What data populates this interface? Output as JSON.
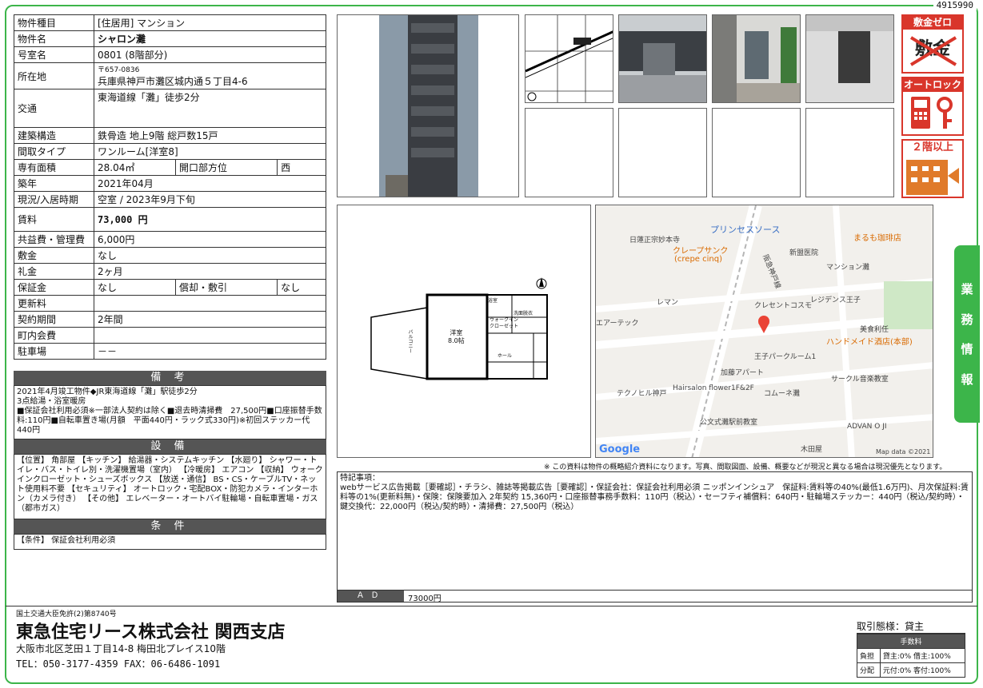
{
  "property_id": "4915990",
  "spec": {
    "type_label": "物件種目",
    "type_value": "[住居用] マンション",
    "name_label": "物件名",
    "name_value": "シャロン灘",
    "room_label": "号室名",
    "room_value": "0801 (8階部分)",
    "address_label": "所在地",
    "zip": "〒657-0836",
    "address_value": "兵庫県神戸市灘区城内通５丁目4-6",
    "transport_label": "交通",
    "transport_value": "東海道線「灘」徒歩2分",
    "structure_label": "建築構造",
    "structure_value": "鉄骨造 地上9階 総戸数15戸",
    "layout_label": "間取タイプ",
    "layout_value": "ワンルーム[洋室8]",
    "area_label": "専有面積",
    "area_value": "28.04㎡",
    "opening_label": "開口部方位",
    "opening_value": "西",
    "built_label": "築年",
    "built_value": "2021年04月",
    "status_label": "現況/入居時期",
    "status_value": "空室 / 2023年9月下旬",
    "rent_label": "賃料",
    "rent_value": "73,000 円",
    "mgmt_label": "共益費・管理費",
    "mgmt_value": "6,000円",
    "deposit_label": "敷金",
    "deposit_value": "なし",
    "key_money_label": "礼金",
    "key_money_value": "2ヶ月",
    "guarantee_label": "保証金",
    "guarantee_value": "なし",
    "amort_label": "償却・敷引",
    "amort_value": "なし",
    "renewal_label": "更新料",
    "renewal_value": "",
    "contract_label": "契約期間",
    "contract_value": "2年間",
    "town_fee_label": "町内会費",
    "town_fee_value": "",
    "parking_label": "駐車場",
    "parking_value": "－－"
  },
  "remarks": {
    "title": "備 考",
    "text": "2021年4月竣工物件◆JR東海道線「灘」駅徒歩2分\n3点給湯・浴室暖房\n■保証会社利用必須※一部法人契約は除く■退去時清掃費　27,500円■口座振替手数料:110円■自転車置き場(月額　平面440円・ラック式330円)※初回ステッカー代440円"
  },
  "equipment": {
    "title": "設 備",
    "text": "【位置】 角部屋 【キッチン】 給湯器・システムキッチン 【水廻り】 シャワー・トイレ・バス・トイレ別・洗濯機置場（室内） 【冷暖房】 エアコン 【収納】 ウォークインクローゼット・シューズボックス 【放送・通信】 BS・CS・ケーブルTV・ネット使用料不要 【セキュリティ】 オートロック・宅配BOX・防犯カメラ・インターホン（カメラ付き） 【その他】 エレベーター・オートバイ駐輪場・自転車置場・ガス（都市ガス）"
  },
  "conditions": {
    "title": "条 件",
    "text": "【条件】 保証会社利用必須"
  },
  "badges": {
    "no_deposit": "敷金ゼロ",
    "no_deposit_strike": "敷金",
    "autolock": "オートロック",
    "second_floor": "２階以上"
  },
  "side_tab": [
    "業",
    "務",
    "情",
    "報"
  ],
  "floorplan": {
    "room": "洋室",
    "size": "8.0帖",
    "closet": "ウォークイン\nクローゼット",
    "hall": "ホール",
    "balcony": "バルコニー",
    "bath": "浴室",
    "wash": "洗面脱衣"
  },
  "map": {
    "labels": [
      "プリンセスソース",
      "日蓮正宗妙本寺",
      "クレープサンク",
      "(crepe cinq)",
      "新盟医院",
      "マンション灘",
      "まるも珈琲店",
      "レマン",
      "クレセントコスモ",
      "レジデンス王子",
      "美食利任",
      "ハンドメイド酒店(本部)",
      "エアーテック",
      "王子パークルーム1",
      "加藤アパート",
      "サークル音楽教室",
      "テクノヒル神戸",
      "Hairsalon flower1F&2F",
      "コムーネ灘",
      "公文式灘駅前教室",
      "ADVAN O JI",
      "木田屋",
      "阪急神戸線"
    ],
    "google": "Google",
    "map_data": "Map data ©2021"
  },
  "disclaimer": "※ この資料は物件の概略紹介資料になります。写真、間取図面、設備、概要などが現況と異なる場合は現況優先となります。",
  "notes": {
    "title": "特記事項：",
    "text": "webサービス広告掲載［要確認］・チラシ、雑誌等掲載広告［要確認］・保証会社：保証会社利用必須 ニッポンインシュア　保証料:賃料等の40%(最低1.6万円)、月次保証料:賃料等の1%(更新料無)・保険：保険要加入 2年契約 15,360円・口座振替事務手数料：110円（税込）・セーフティ補償料：640円・駐輪場ステッカー：440円（税込/契約時）・鍵交換代：22,000円（税込/契約時）・清掃費：27,500円（税込）"
  },
  "ad": {
    "label": "ＡＤ",
    "value": "73000円"
  },
  "footer": {
    "license": "国土交通大臣免許(2)第8740号",
    "company": "東急住宅リース株式会社 関西支店",
    "address": "大阪市北区芝田１丁目14-8 梅田北プレイス10階",
    "tel": "TEL：050-3177-4359 FAX：06-6486-1091",
    "deal_type": "取引態様：貸主",
    "fee_header": "手数料",
    "burden_label": "負担",
    "burden_value": "貸主:0% 借主:100%",
    "split_label": "分配",
    "split_value": "元付:0% 客付:100%"
  }
}
